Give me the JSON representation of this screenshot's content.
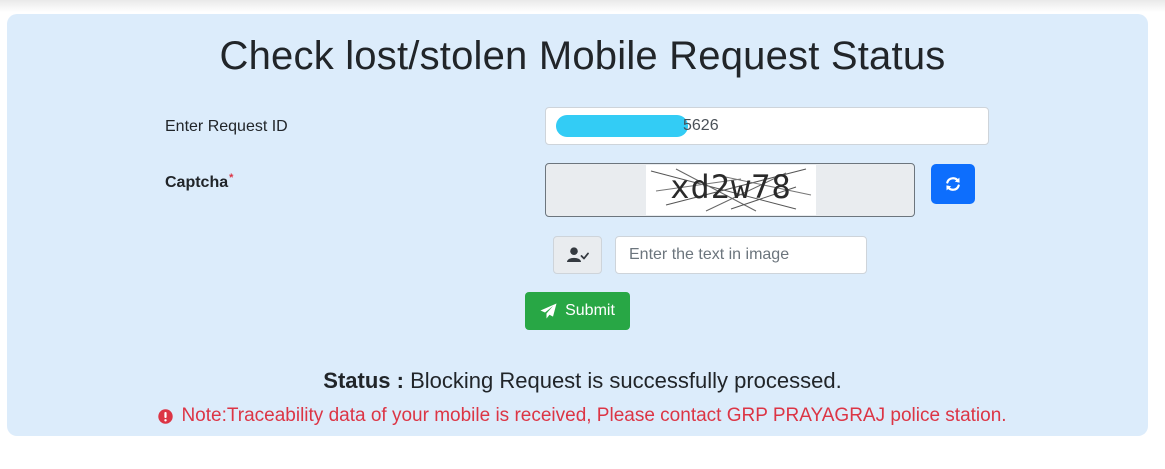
{
  "page": {
    "title": "Check lost/stolen Mobile Request Status"
  },
  "request": {
    "label": "Enter Request ID",
    "value_visible": "5626"
  },
  "captcha": {
    "label": "Captcha",
    "required_mark": "*",
    "image_text": "xd2w78",
    "refresh_icon": "refresh-icon",
    "input_icon": "user-check-icon",
    "input_placeholder": "Enter the text in image"
  },
  "submit": {
    "label": "Submit",
    "icon": "paper-plane-icon"
  },
  "status": {
    "label": "Status :",
    "message": "Blocking Request is successfully processed."
  },
  "note": {
    "icon": "exclamation-circle-icon",
    "text": "Note:Traceability data of your mobile is received, Please contact GRP PRAYAGRAJ police station."
  },
  "colors": {
    "panel_bg": "#dcecfb",
    "primary": "#0d6efd",
    "success": "#28a745",
    "danger": "#dc3545",
    "redaction": "#33ccf5"
  }
}
